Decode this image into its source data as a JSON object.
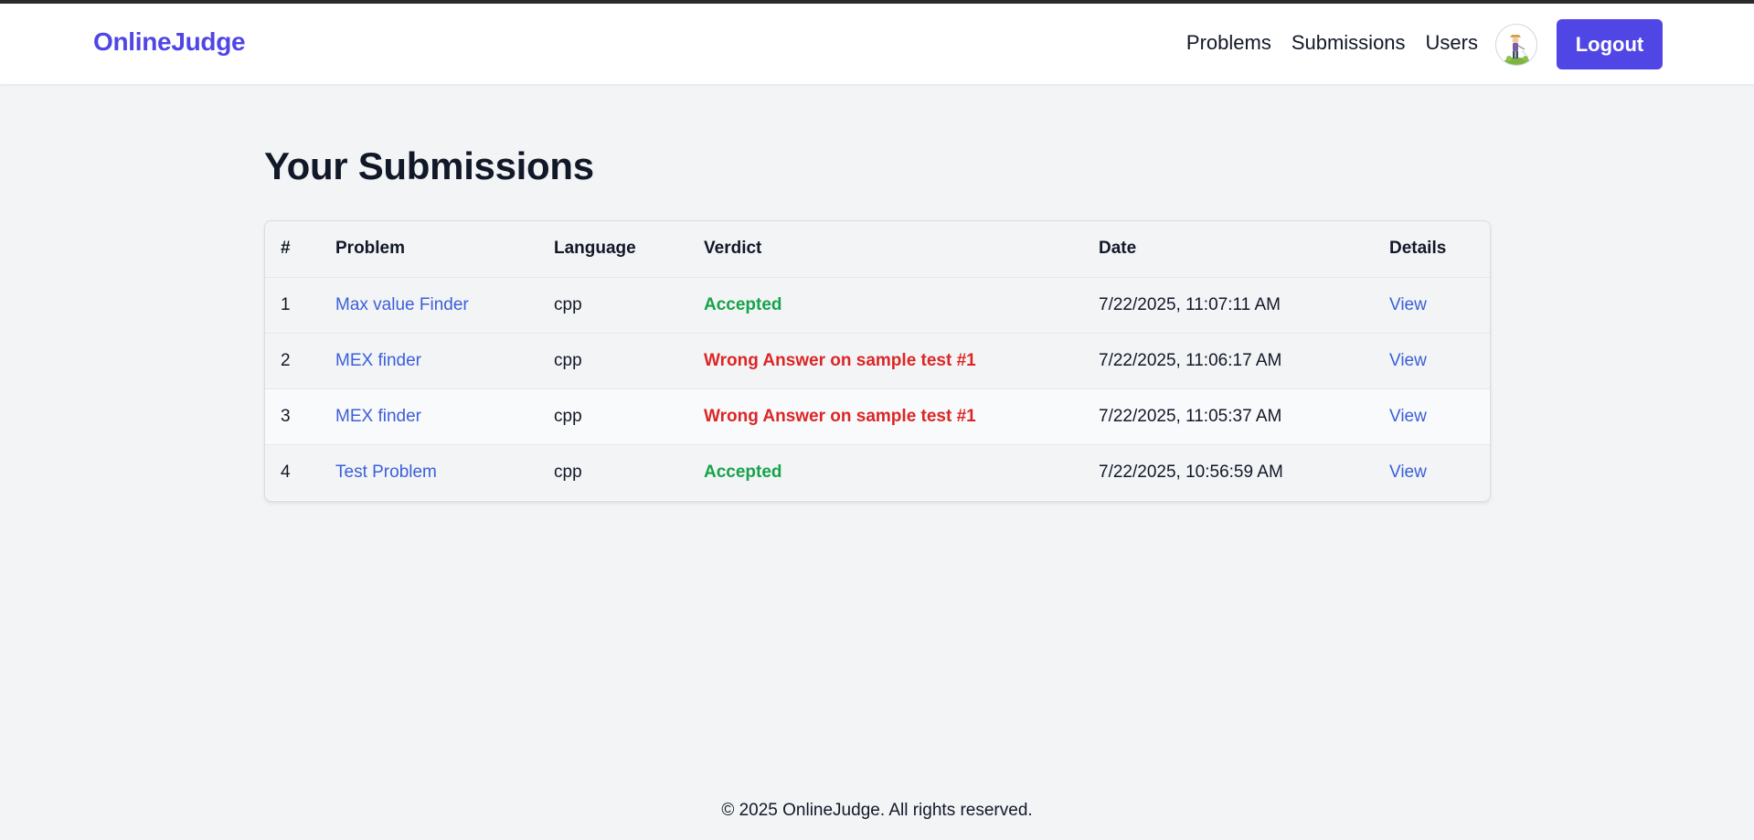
{
  "navbar": {
    "brand": "OnlineJudge",
    "links": [
      "Problems",
      "Submissions",
      "Users"
    ],
    "logout_label": "Logout",
    "avatar_icon": "user-avatar-icon"
  },
  "page": {
    "title": "Your Submissions"
  },
  "table": {
    "headers": [
      "#",
      "Problem",
      "Language",
      "Verdict",
      "Date",
      "Details"
    ],
    "rows": [
      {
        "num": "1",
        "problem": "Max value Finder",
        "language": "cpp",
        "verdict": "Accepted",
        "status": "accepted",
        "date": "7/22/2025, 11:07:11 AM",
        "details": "View"
      },
      {
        "num": "2",
        "problem": "MEX finder",
        "language": "cpp",
        "verdict": "Wrong Answer on sample test #1",
        "status": "wrong",
        "date": "7/22/2025, 11:06:17 AM",
        "details": "View"
      },
      {
        "num": "3",
        "problem": "MEX finder",
        "language": "cpp",
        "verdict": "Wrong Answer on sample test #1",
        "status": "wrong",
        "date": "7/22/2025, 11:05:37 AM",
        "details": "View"
      },
      {
        "num": "4",
        "problem": "Test Problem",
        "language": "cpp",
        "verdict": "Accepted",
        "status": "accepted",
        "date": "7/22/2025, 10:56:59 AM",
        "details": "View"
      }
    ]
  },
  "colors": {
    "brand": "#4f46e5",
    "link": "#3b5fd9",
    "accepted": "#16a34a",
    "wrong": "#dc2626"
  },
  "footer": {
    "text": "© 2025 OnlineJudge. All rights reserved."
  }
}
